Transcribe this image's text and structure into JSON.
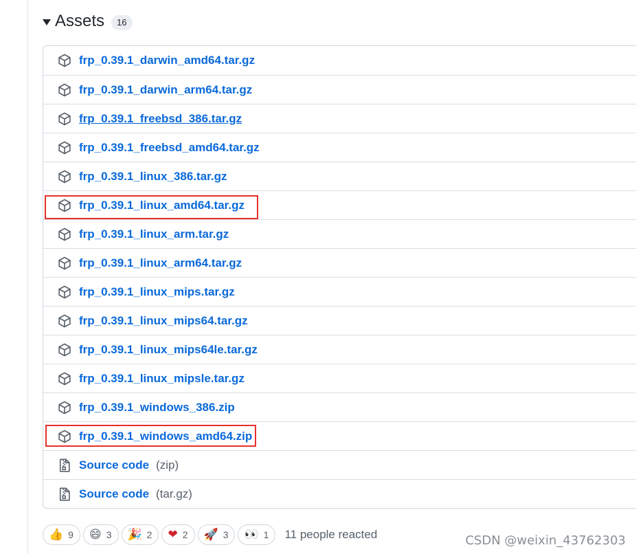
{
  "assets": {
    "title": "Assets",
    "count": "16",
    "items": [
      {
        "name": "frp_0.39.1_darwin_amd64.tar.gz",
        "icon": "package-icon"
      },
      {
        "name": "frp_0.39.1_darwin_arm64.tar.gz",
        "icon": "package-icon"
      },
      {
        "name": "frp_0.39.1_freebsd_386.tar.gz",
        "icon": "package-icon"
      },
      {
        "name": "frp_0.39.1_freebsd_amd64.tar.gz",
        "icon": "package-icon"
      },
      {
        "name": "frp_0.39.1_linux_386.tar.gz",
        "icon": "package-icon"
      },
      {
        "name": "frp_0.39.1_linux_amd64.tar.gz",
        "icon": "package-icon"
      },
      {
        "name": "frp_0.39.1_linux_arm.tar.gz",
        "icon": "package-icon"
      },
      {
        "name": "frp_0.39.1_linux_arm64.tar.gz",
        "icon": "package-icon"
      },
      {
        "name": "frp_0.39.1_linux_mips.tar.gz",
        "icon": "package-icon"
      },
      {
        "name": "frp_0.39.1_linux_mips64.tar.gz",
        "icon": "package-icon"
      },
      {
        "name": "frp_0.39.1_linux_mips64le.tar.gz",
        "icon": "package-icon"
      },
      {
        "name": "frp_0.39.1_linux_mipsle.tar.gz",
        "icon": "package-icon"
      },
      {
        "name": "frp_0.39.1_windows_386.zip",
        "icon": "package-icon"
      },
      {
        "name": "frp_0.39.1_windows_amd64.zip",
        "icon": "package-icon"
      },
      {
        "name": "Source code",
        "suffix": "(zip)",
        "icon": "file-zip-icon"
      },
      {
        "name": "Source code",
        "suffix": "(tar.gz)",
        "icon": "file-zip-icon"
      }
    ]
  },
  "reactions": {
    "items": [
      {
        "emoji": "👍",
        "count": "9",
        "icon": "thumbs-up-icon"
      },
      {
        "emoji": "😄",
        "count": "3",
        "icon": "laugh-icon"
      },
      {
        "emoji": "🎉",
        "count": "2",
        "icon": "hooray-icon"
      },
      {
        "emoji": "❤",
        "count": "2",
        "icon": "heart-icon"
      },
      {
        "emoji": "🚀",
        "count": "3",
        "icon": "rocket-icon"
      },
      {
        "emoji": "👀",
        "count": "1",
        "icon": "eyes-icon"
      }
    ],
    "summary": "11 people reacted"
  },
  "watermark": "CSDN @weixin_43762303",
  "colors": {
    "link": "#0969da",
    "highlight_box": "#e5302b",
    "border": "#d0d7de"
  }
}
